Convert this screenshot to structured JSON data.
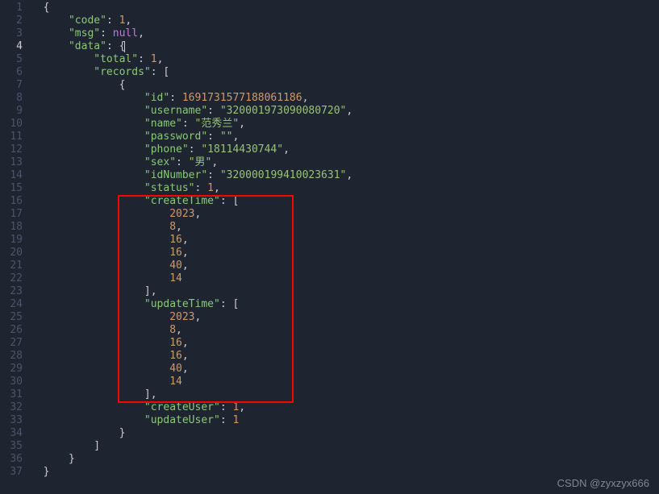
{
  "lineNumbers": [
    "1",
    "2",
    "3",
    "4",
    "5",
    "6",
    "7",
    "8",
    "9",
    "10",
    "11",
    "12",
    "13",
    "14",
    "15",
    "16",
    "17",
    "18",
    "19",
    "20",
    "21",
    "22",
    "23",
    "24",
    "25",
    "26",
    "27",
    "28",
    "29",
    "30",
    "31",
    "32",
    "33",
    "34",
    "35",
    "36",
    "37"
  ],
  "activeLine": "4",
  "json": {
    "code": "1",
    "msg": "null",
    "data": {
      "total": "1",
      "records": {
        "id": "1691731577188061186",
        "username": "\"320001973090080720\"",
        "name": "\"范秀兰\"",
        "password": "\"\"",
        "phone": "\"18114430744\"",
        "sex": "\"男\"",
        "idNumber": "\"320000199410023631\"",
        "status": "1",
        "createTime": [
          "2023",
          "8",
          "16",
          "16",
          "40",
          "14"
        ],
        "updateTime": [
          "2023",
          "8",
          "16",
          "16",
          "40",
          "14"
        ],
        "createUser": "1",
        "updateUser": "1"
      }
    }
  },
  "keys": {
    "code": "\"code\"",
    "msg": "\"msg\"",
    "data": "\"data\"",
    "total": "\"total\"",
    "records": "\"records\"",
    "id": "\"id\"",
    "username": "\"username\"",
    "name": "\"name\"",
    "password": "\"password\"",
    "phone": "\"phone\"",
    "sex": "\"sex\"",
    "idNumber": "\"idNumber\"",
    "status": "\"status\"",
    "createTime": "\"createTime\"",
    "updateTime": "\"updateTime\"",
    "createUser": "\"createUser\"",
    "updateUser": "\"updateUser\""
  },
  "watermark": "CSDN @zyxzyx666",
  "chart_data": {
    "type": "table",
    "title": "JSON response object with datetime arrays highlighted",
    "highlighted_fields": [
      "createTime",
      "updateTime"
    ],
    "createTime": [
      2023,
      8,
      16,
      16,
      40,
      14
    ],
    "updateTime": [
      2023,
      8,
      16,
      16,
      40,
      14
    ]
  }
}
